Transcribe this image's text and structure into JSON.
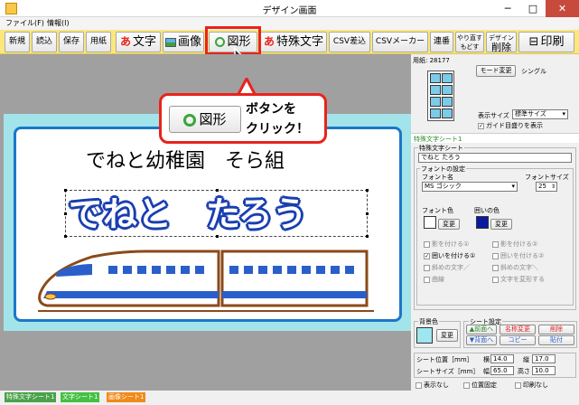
{
  "window": {
    "title": "デザイン画面",
    "minimize": "─",
    "maximize": "□",
    "close": "✕"
  },
  "menu": {
    "file": "ファイル(F)",
    "info": "情報(I)"
  },
  "toolbar": {
    "new": "新規",
    "open": "読込",
    "save": "保存",
    "paper": "用紙",
    "text": "文字",
    "image": "画像",
    "shape": "図形",
    "special_text": "特殊文字",
    "csv_insert": "CSV差込",
    "csv_maker": "CSVメーカー",
    "serial": "連番",
    "undo_top": "やり直す",
    "undo_bottom": "もどす",
    "delete_top": "デザイン",
    "delete_bottom": "削除",
    "print": "印刷"
  },
  "canvas": {
    "line1": "でねと幼稚園　そら組",
    "line2": "でねと　たろう"
  },
  "callout": {
    "button_label": "図形",
    "text_line1": "ボタンを",
    "text_line2": "クリック！"
  },
  "panel": {
    "paper_label": "用紙: 28177",
    "mode_change": "モード変更",
    "mode_value": "シングル",
    "display_size_label": "表示サイズ",
    "display_size_value": "標準サイズ",
    "guide_checkbox": "ガイド目盛りを表示",
    "section_title": "特殊文字シート1",
    "sheet_group": "特殊文字シート",
    "sheet_text": "でねと たろう",
    "font_group": "フォントの設定",
    "font_name_label": "フォント名",
    "font_name_value": "MS ゴシック",
    "font_size_label": "フォントサイズ",
    "font_size_value": "25",
    "font_color_label": "フォント色",
    "border_color_label": "囲いの色",
    "change": "変更",
    "font_color": "#ffffff",
    "border_color": "#0a1aa0",
    "opts": {
      "shadow1": "影を付ける①",
      "shadow2": "影を付ける②",
      "border1": "囲いを付ける①",
      "border2": "囲いを付ける②",
      "italic1": "斜めの文字／",
      "italic2": "斜めの文字＼",
      "curve": "曲線",
      "deform": "文字を変形する"
    },
    "bg_group": "背景色",
    "bg_color": "#9ee7ee",
    "sheet_settings": "シート設定",
    "front": "▲前面へ",
    "back": "▼背面へ",
    "rename": "名称変更",
    "copy": "コピー",
    "delete": "削除",
    "paste": "貼付",
    "pos_label": "シート位置［mm］",
    "size_label": "シートサイズ［mm］",
    "x_label": "横",
    "x_value": "14.0",
    "y_label": "縦",
    "y_value": "17.0",
    "w_label": "幅",
    "w_value": "65.0",
    "h_label": "高さ",
    "h_value": "10.0",
    "hide": "表示なし",
    "lock": "位置固定",
    "noprint": "印刷なし"
  },
  "status_tabs": [
    {
      "label": "特殊文字シート1",
      "color": "#4aa24a"
    },
    {
      "label": "文字シート1",
      "color": "#44c044"
    },
    {
      "label": "画像シート1",
      "color": "#f08a1a"
    }
  ]
}
